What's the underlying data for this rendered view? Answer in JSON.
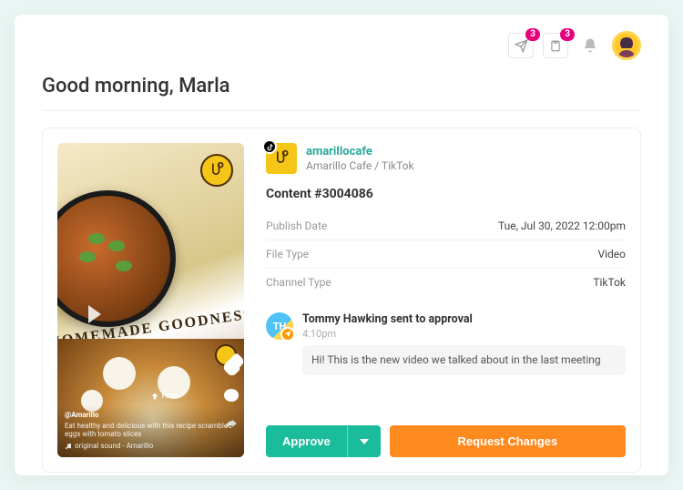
{
  "topbar": {
    "send_badge": "3",
    "clipboard_badge": "3"
  },
  "greeting": "Good morning, Marla",
  "preview": {
    "tagline": "HOMEMADE GOODNESS",
    "handle": "@Amarillo",
    "caption": "Eat healthy and delicious with this recipe scrambled eggs with tomato slices",
    "sound": "original sound - Amarillo",
    "hide_label": "Hide"
  },
  "channel": {
    "name": "amarillocafe",
    "sub": "Amarillo Cafe / TikTok"
  },
  "content": {
    "heading": "Content #3004086",
    "rows": [
      {
        "label": "Publish Date",
        "value": "Tue, Jul 30, 2022 12:00pm"
      },
      {
        "label": "File Type",
        "value": "Video"
      },
      {
        "label": "Channel Type",
        "value": "TikTok"
      }
    ]
  },
  "activity": {
    "initials": "TH",
    "title": "Tommy Hawking sent to approval",
    "time": "4:10pm",
    "message": "Hi! This is the new video we talked about in the last meeting"
  },
  "actions": {
    "approve": "Approve",
    "request": "Request Changes"
  }
}
